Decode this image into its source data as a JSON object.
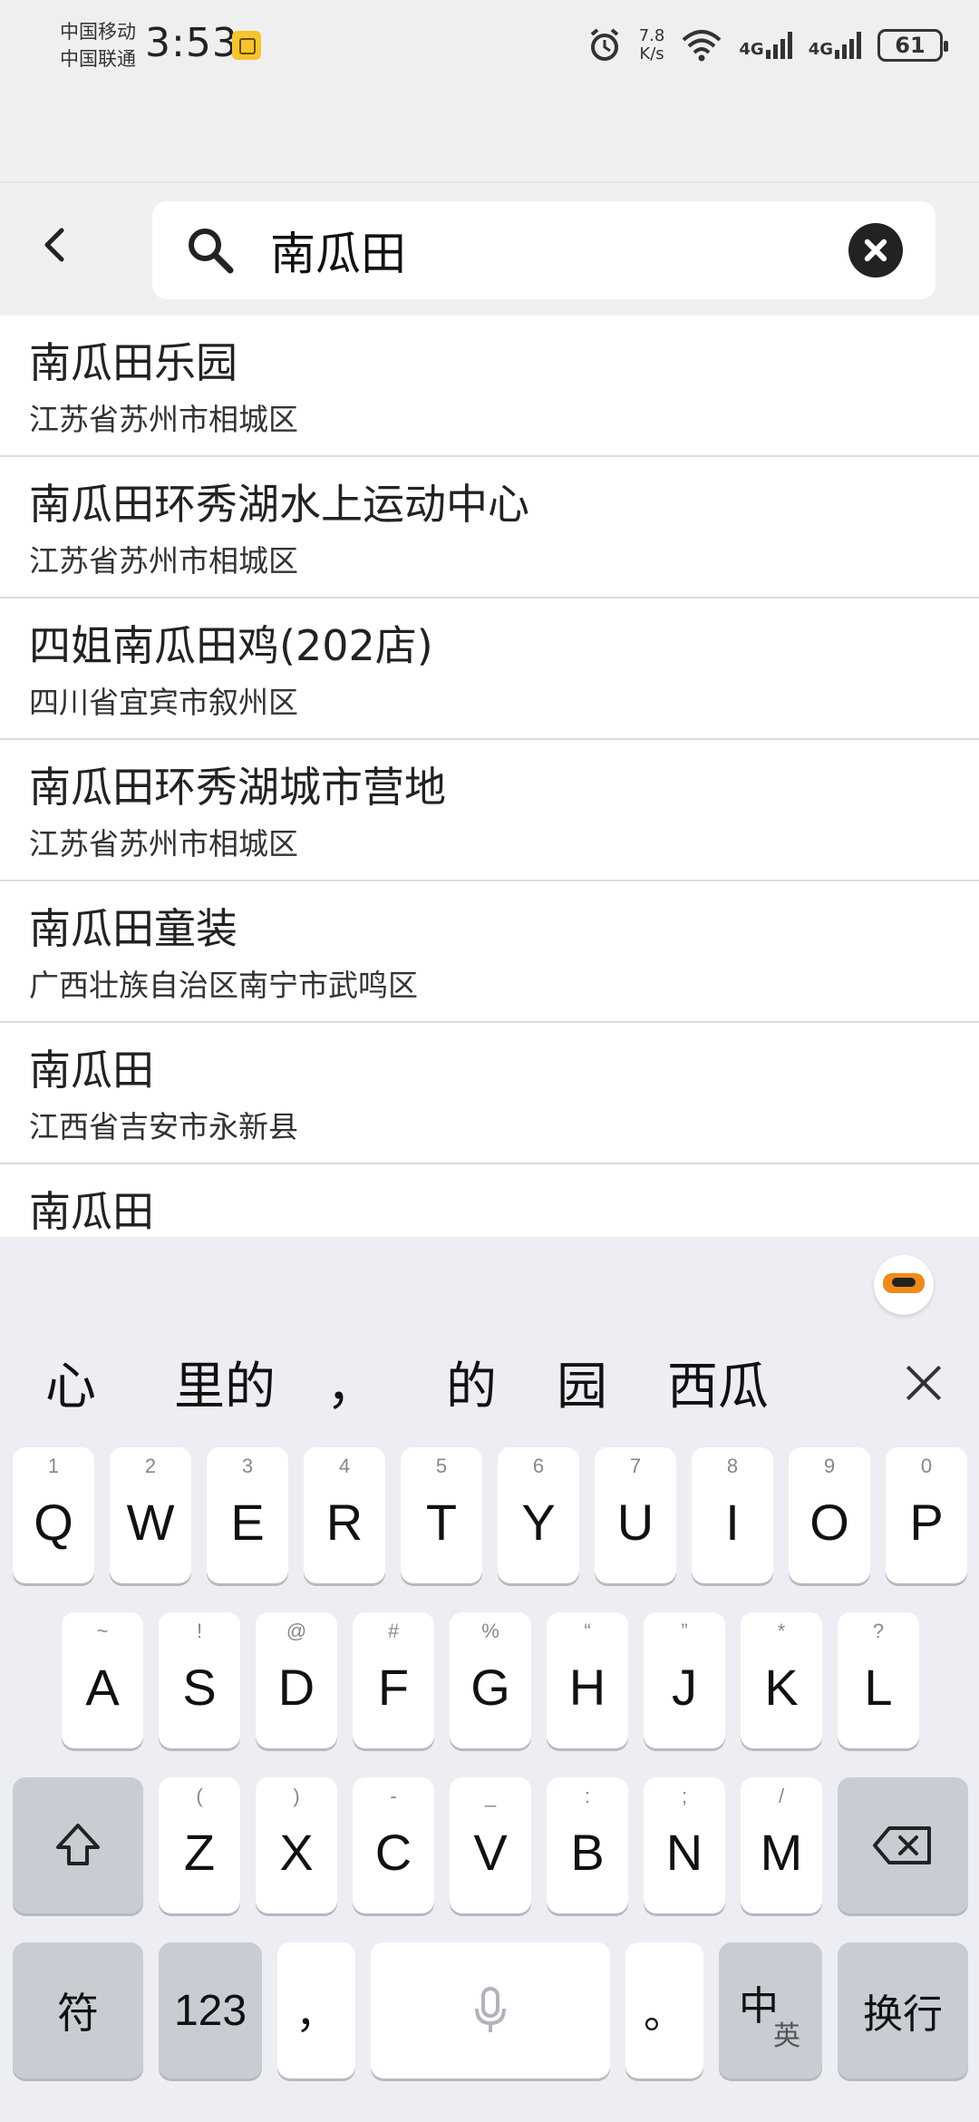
{
  "status": {
    "carrier1": "中国移动",
    "carrier2": "中国联通",
    "time": "3:53",
    "netspeed_value": "7.8",
    "netspeed_unit": "K/s",
    "sig1": "4G",
    "sig2": "4G",
    "battery": "61"
  },
  "search": {
    "query": "南瓜田"
  },
  "results": [
    {
      "title": "南瓜田乐园",
      "subtitle": "江苏省苏州市相城区"
    },
    {
      "title": "南瓜田环秀湖水上运动中心",
      "subtitle": "江苏省苏州市相城区"
    },
    {
      "title": "四姐南瓜田鸡(202店)",
      "subtitle": "四川省宜宾市叙州区"
    },
    {
      "title": "南瓜田环秀湖城市营地",
      "subtitle": "江苏省苏州市相城区"
    },
    {
      "title": "南瓜田童装",
      "subtitle": "广西壮族自治区南宁市武鸣区"
    },
    {
      "title": "南瓜田",
      "subtitle": "江西省吉安市永新县"
    },
    {
      "title": "南瓜田",
      "subtitle": ""
    }
  ],
  "keyboard": {
    "candidates": [
      "心",
      "里的",
      "，",
      "的",
      "园",
      "西瓜"
    ],
    "row1": [
      {
        "hint": "1",
        "key": "Q"
      },
      {
        "hint": "2",
        "key": "W"
      },
      {
        "hint": "3",
        "key": "E"
      },
      {
        "hint": "4",
        "key": "R"
      },
      {
        "hint": "5",
        "key": "T"
      },
      {
        "hint": "6",
        "key": "Y"
      },
      {
        "hint": "7",
        "key": "U"
      },
      {
        "hint": "8",
        "key": "I"
      },
      {
        "hint": "9",
        "key": "O"
      },
      {
        "hint": "0",
        "key": "P"
      }
    ],
    "row2": [
      {
        "hint": "~",
        "key": "A"
      },
      {
        "hint": "!",
        "key": "S"
      },
      {
        "hint": "@",
        "key": "D"
      },
      {
        "hint": "#",
        "key": "F"
      },
      {
        "hint": "%",
        "key": "G"
      },
      {
        "hint": "“",
        "key": "H"
      },
      {
        "hint": "”",
        "key": "J"
      },
      {
        "hint": "*",
        "key": "K"
      },
      {
        "hint": "?",
        "key": "L"
      }
    ],
    "row3": [
      {
        "hint": "(",
        "key": "Z"
      },
      {
        "hint": ")",
        "key": "X"
      },
      {
        "hint": "-",
        "key": "C"
      },
      {
        "hint": "_",
        "key": "V"
      },
      {
        "hint": ":",
        "key": "B"
      },
      {
        "hint": ";",
        "key": "N"
      },
      {
        "hint": "/",
        "key": "M"
      }
    ],
    "symbols_label": "符",
    "numbers_label": "123",
    "comma_label": "，",
    "period_label": "。",
    "lang_main": "中",
    "lang_sub": "英",
    "enter_label": "换行"
  },
  "icons": {
    "back": "chevron-left-icon",
    "search": "search-icon",
    "clear": "clear-icon",
    "shift": "shift-icon",
    "backspace": "backspace-icon",
    "mic": "microphone-icon"
  }
}
